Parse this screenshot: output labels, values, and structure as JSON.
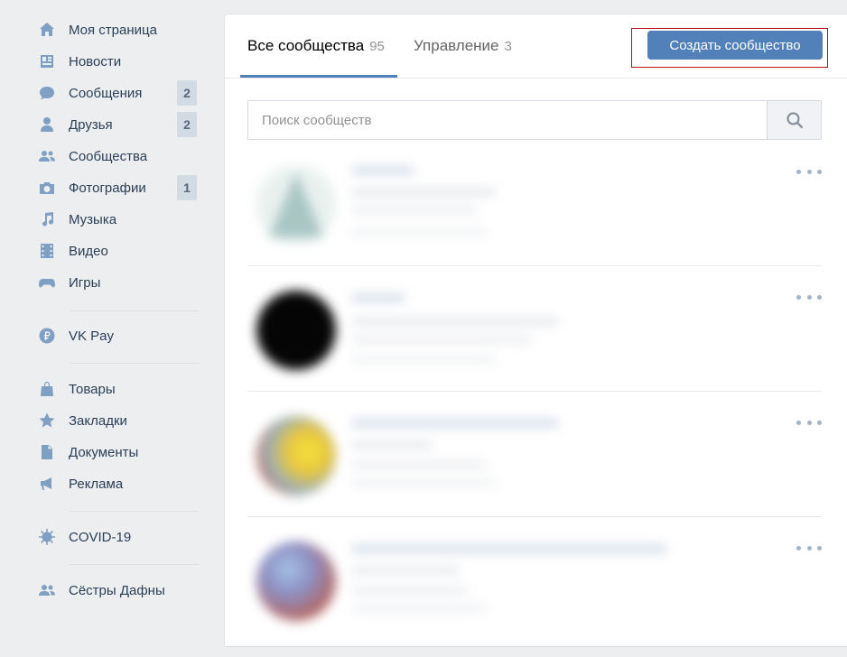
{
  "sidebar": {
    "items": [
      {
        "label": "Моя страница",
        "icon": "home-icon"
      },
      {
        "label": "Новости",
        "icon": "news-icon"
      },
      {
        "label": "Сообщения",
        "icon": "messages-icon",
        "badge": "2"
      },
      {
        "label": "Друзья",
        "icon": "friends-icon",
        "badge": "2"
      },
      {
        "label": "Сообщества",
        "icon": "communities-icon"
      },
      {
        "label": "Фотографии",
        "icon": "camera-icon",
        "badge": "1"
      },
      {
        "label": "Музыка",
        "icon": "music-icon"
      },
      {
        "label": "Видео",
        "icon": "video-icon"
      },
      {
        "label": "Игры",
        "icon": "gamepad-icon"
      },
      {
        "label": "VK Pay",
        "icon": "vkpay-icon"
      },
      {
        "label": "Товары",
        "icon": "bag-icon"
      },
      {
        "label": "Закладки",
        "icon": "star-icon"
      },
      {
        "label": "Документы",
        "icon": "document-icon"
      },
      {
        "label": "Реклама",
        "icon": "megaphone-icon"
      },
      {
        "label": "COVID-19",
        "icon": "virus-icon"
      },
      {
        "label": "Сёстры Дафны",
        "icon": "group-icon"
      }
    ]
  },
  "tabs": [
    {
      "label": "Все сообщества",
      "count": "95",
      "active": true
    },
    {
      "label": "Управление",
      "count": "3",
      "active": false
    }
  ],
  "create_button": "Создать сообщество",
  "search": {
    "placeholder": "Поиск сообществ",
    "value": ""
  },
  "colors": {
    "accent": "#5181b8",
    "highlight": "#b8111b",
    "background": "#edeef0"
  }
}
